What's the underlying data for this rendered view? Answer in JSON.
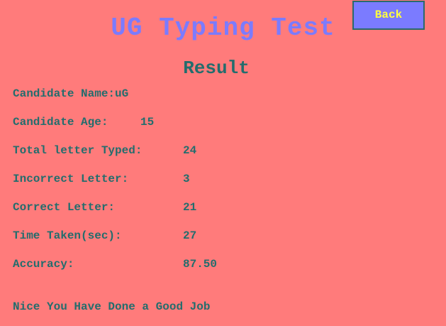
{
  "header": {
    "title": "UG Typing Test",
    "back_label": "Back"
  },
  "result": {
    "heading": "Result",
    "candidate_name_label": "Candidate Name:",
    "candidate_name": "uG",
    "candidate_age_label": "Candidate Age:",
    "candidate_age": "15",
    "total_label": "Total letter Typed:",
    "total": "24",
    "incorrect_label": "Incorrect Letter:",
    "incorrect": "3",
    "correct_label": "Correct Letter:",
    "correct": "21",
    "time_label": "Time Taken(sec):",
    "time": "27",
    "accuracy_label": "Accuracy:",
    "accuracy": "87.50",
    "message": "Nice You Have Done a Good Job"
  },
  "colors": {
    "background": "#ff7b7b",
    "title": "#7b7bff",
    "text": "#236d6d",
    "button_bg": "#7b7bff",
    "button_text": "#ffff40"
  }
}
